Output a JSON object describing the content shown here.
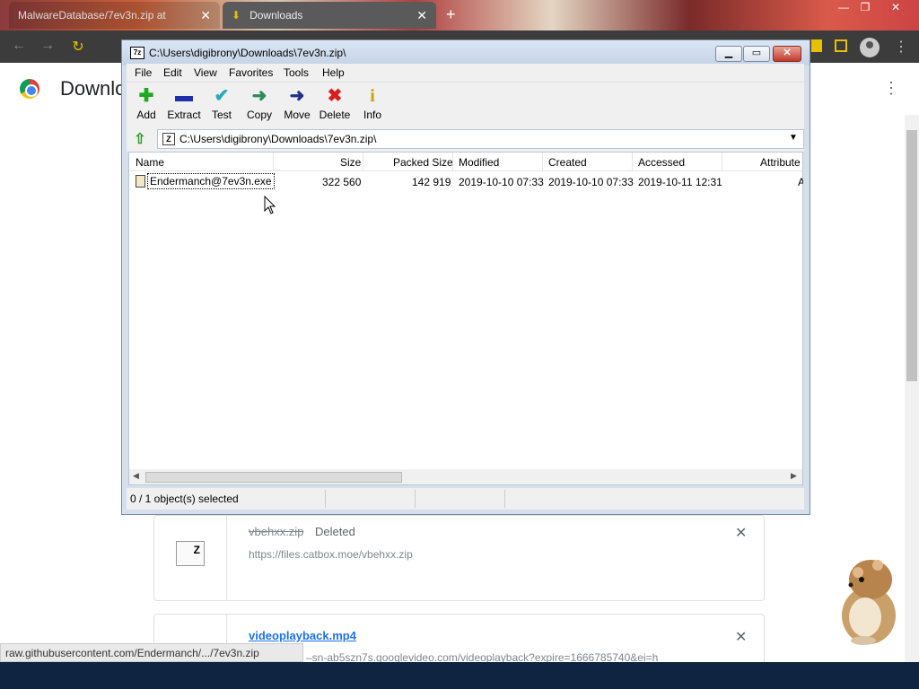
{
  "browser": {
    "tabs": [
      {
        "label": "MalwareDatabase/7ev3n.zip at"
      },
      {
        "label": "Downloads"
      }
    ],
    "new_tab": "+"
  },
  "page": {
    "title": "Downlo",
    "downloads": [
      {
        "name": "vbehxx.zip",
        "status": "Deleted",
        "url": "https://files.catbox.moe/vbehxx.zip"
      },
      {
        "name": "videoplayback.mp4",
        "url": "–sn-ab5szn7s.googlevideo.com/videoplayback?expire=1666785740&ei=h"
      }
    ],
    "status_bubble": "raw.githubusercontent.com/Endermanch/.../7ev3n.zip"
  },
  "zip": {
    "title": "C:\\Users\\digibrony\\Downloads\\7ev3n.zip\\",
    "app_icon": "7z",
    "menu": [
      "File",
      "Edit",
      "View",
      "Favorites",
      "Tools",
      "Help"
    ],
    "toolbar": [
      {
        "label": "Add",
        "icon": "plus-icon",
        "glyph": "✚",
        "color": "#1fa81f"
      },
      {
        "label": "Extract",
        "icon": "minus-icon",
        "glyph": "▬",
        "color": "#1f2fa8"
      },
      {
        "label": "Test",
        "icon": "check-icon",
        "glyph": "✔",
        "color": "#2aa8b8"
      },
      {
        "label": "Copy",
        "icon": "arrow-right-green-icon",
        "glyph": "➜",
        "color": "#2a8a5a"
      },
      {
        "label": "Move",
        "icon": "arrow-right-blue-icon",
        "glyph": "➜",
        "color": "#1f2f8a"
      },
      {
        "label": "Delete",
        "icon": "x-icon",
        "glyph": "✖",
        "color": "#d61f1f"
      },
      {
        "label": "Info",
        "icon": "info-icon",
        "glyph": "i",
        "color": "#c8a400"
      }
    ],
    "address": "C:\\Users\\digibrony\\Downloads\\7ev3n.zip\\",
    "columns": [
      "Name",
      "Size",
      "Packed Size",
      "Modified",
      "Created",
      "Accessed",
      "Attribute"
    ],
    "rows": [
      {
        "name": "Endermanch@7ev3n.exe",
        "size": "322 560",
        "packed": "142 919",
        "modified": "2019-10-10 07:33",
        "created": "2019-10-10 07:33",
        "accessed": "2019-10-11 12:31",
        "attr": "A"
      }
    ],
    "status": "0 / 1 object(s) selected"
  }
}
